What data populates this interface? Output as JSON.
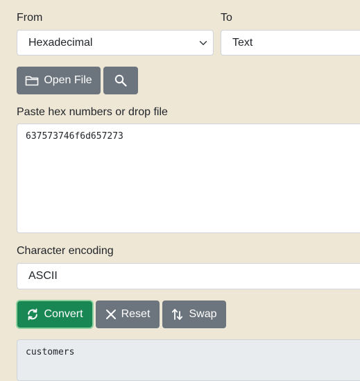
{
  "from": {
    "label": "From",
    "selected": "Hexadecimal"
  },
  "to": {
    "label": "To",
    "selected": "Text"
  },
  "toolbar": {
    "open_file_label": "Open File"
  },
  "input": {
    "label": "Paste hex numbers or drop file",
    "value": "637573746f6d657273"
  },
  "encoding": {
    "label": "Character encoding",
    "selected": "ASCII"
  },
  "actions": {
    "convert_label": "Convert",
    "reset_label": "Reset",
    "swap_label": "Swap"
  },
  "output": {
    "value": "customers"
  },
  "colors": {
    "background": "#efe7d6",
    "button_gray": "#6c757d",
    "button_green": "#198754",
    "output_bg": "#e9ecef"
  },
  "icons": {
    "open_file": "folder-icon",
    "search": "search-icon",
    "convert": "refresh-icon",
    "reset": "close-icon",
    "swap": "swap-arrows-icon",
    "select": "chevron-down-icon"
  }
}
